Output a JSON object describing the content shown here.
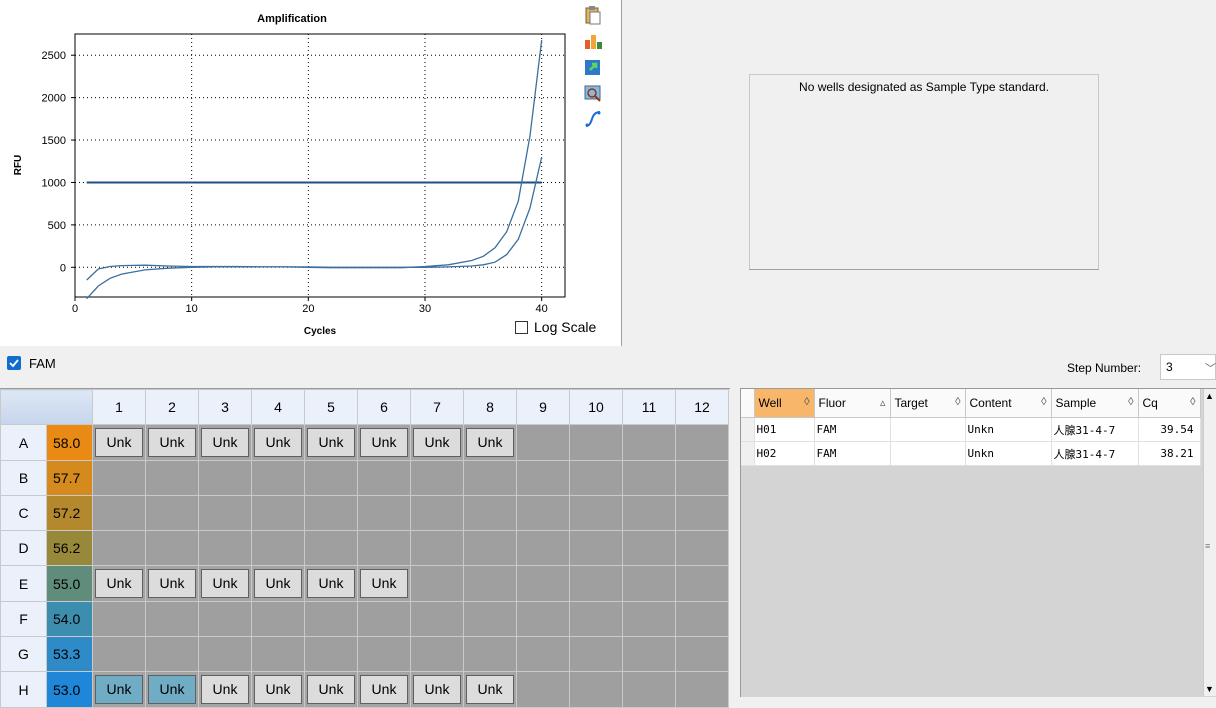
{
  "chart": {
    "title": "Amplification",
    "xlabel": "Cycles",
    "ylabel": "RFU",
    "log_scale_label": "Log Scale"
  },
  "chart_data": {
    "type": "line",
    "title": "Amplification",
    "xlabel": "Cycles",
    "ylabel": "RFU",
    "xlim": [
      0,
      42
    ],
    "ylim": [
      -350,
      2750
    ],
    "xticks": [
      0,
      10,
      20,
      30,
      40
    ],
    "yticks": [
      0,
      500,
      1000,
      1500,
      2000,
      2500
    ],
    "grid": true,
    "threshold": 1000,
    "threshold_x": [
      1,
      40
    ],
    "series": [
      {
        "x": [
          1,
          2,
          3,
          4,
          6,
          8,
          10,
          12,
          14,
          16,
          18,
          20,
          22,
          24,
          26,
          28,
          30,
          32,
          34,
          35,
          36,
          37,
          38,
          39,
          40
        ],
        "values": [
          -150,
          -20,
          10,
          20,
          25,
          15,
          10,
          10,
          10,
          5,
          5,
          0,
          -5,
          -5,
          -5,
          -5,
          10,
          30,
          80,
          130,
          230,
          420,
          780,
          1550,
          2680
        ]
      },
      {
        "x": [
          1,
          2,
          3,
          4,
          6,
          8,
          10,
          12,
          14,
          16,
          18,
          20,
          22,
          24,
          26,
          28,
          30,
          32,
          34,
          35,
          36,
          37,
          38,
          39,
          40
        ],
        "values": [
          -370,
          -220,
          -130,
          -80,
          -30,
          -10,
          0,
          5,
          5,
          5,
          5,
          5,
          0,
          0,
          0,
          0,
          0,
          5,
          15,
          30,
          60,
          150,
          330,
          700,
          1300
        ]
      }
    ]
  },
  "standard_panel": {
    "message": "No wells designated as Sample Type standard."
  },
  "fluor_bar": {
    "fam_label": "FAM",
    "step_label": "Step Number:",
    "step_value": "3"
  },
  "plate": {
    "columns": [
      "1",
      "2",
      "3",
      "4",
      "5",
      "6",
      "7",
      "8",
      "9",
      "10",
      "11",
      "12"
    ],
    "rows": [
      {
        "label": "A",
        "temp": "58.0",
        "color": "#e88a14",
        "wells": [
          "Unk",
          "Unk",
          "Unk",
          "Unk",
          "Unk",
          "Unk",
          "Unk",
          "Unk",
          "",
          "",
          "",
          ""
        ],
        "selected": []
      },
      {
        "label": "B",
        "temp": "57.7",
        "color": "#d58a1e",
        "wells": [
          "",
          "",
          "",
          "",
          "",
          "",
          "",
          "",
          "",
          "",
          "",
          ""
        ],
        "selected": []
      },
      {
        "label": "C",
        "temp": "57.2",
        "color": "#b4882c",
        "wells": [
          "",
          "",
          "",
          "",
          "",
          "",
          "",
          "",
          "",
          "",
          "",
          ""
        ],
        "selected": []
      },
      {
        "label": "D",
        "temp": "56.2",
        "color": "#98893a",
        "wells": [
          "",
          "",
          "",
          "",
          "",
          "",
          "",
          "",
          "",
          "",
          "",
          ""
        ],
        "selected": []
      },
      {
        "label": "E",
        "temp": "55.0",
        "color": "#5f8c7b",
        "wells": [
          "Unk",
          "Unk",
          "Unk",
          "Unk",
          "Unk",
          "Unk",
          "",
          "",
          "",
          "",
          "",
          ""
        ],
        "selected": []
      },
      {
        "label": "F",
        "temp": "54.0",
        "color": "#3d8dae",
        "wells": [
          "",
          "",
          "",
          "",
          "",
          "",
          "",
          "",
          "",
          "",
          "",
          ""
        ],
        "selected": []
      },
      {
        "label": "G",
        "temp": "53.3",
        "color": "#2f8ac8",
        "wells": [
          "",
          "",
          "",
          "",
          "",
          "",
          "",
          "",
          "",
          "",
          "",
          ""
        ],
        "selected": []
      },
      {
        "label": "H",
        "temp": "53.0",
        "color": "#1f86d8",
        "wells": [
          "Unk",
          "Unk",
          "Unk",
          "Unk",
          "Unk",
          "Unk",
          "Unk",
          "Unk",
          "",
          "",
          "",
          ""
        ],
        "selected": [
          0,
          1
        ]
      }
    ]
  },
  "results": {
    "columns": [
      "Well",
      "Fluor",
      "Target",
      "Content",
      "Sample",
      "Cq"
    ],
    "rows": [
      [
        "H01",
        "FAM",
        "",
        "Unkn",
        "人腺31-4-7",
        "39.54"
      ],
      [
        "H02",
        "FAM",
        "",
        "Unkn",
        "人腺31-4-7",
        "38.21"
      ]
    ]
  }
}
